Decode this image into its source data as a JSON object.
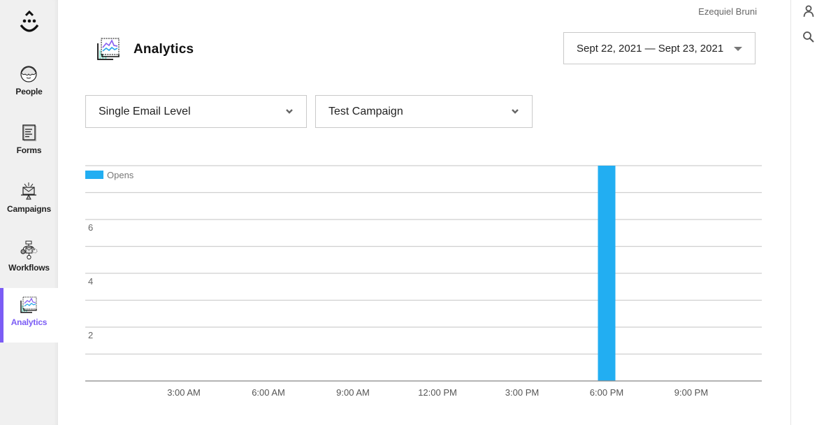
{
  "sidebar": {
    "logo": "smiley-logo-icon",
    "items": [
      {
        "label": "People",
        "icon": "people-icon",
        "active": false
      },
      {
        "label": "Forms",
        "icon": "forms-icon",
        "active": false
      },
      {
        "label": "Campaigns",
        "icon": "campaigns-icon",
        "active": false
      },
      {
        "label": "Workflows",
        "icon": "workflows-icon",
        "active": false
      },
      {
        "label": "Analytics",
        "icon": "analytics-icon",
        "active": true
      }
    ]
  },
  "header": {
    "user_name": "Ezequiel Bruni",
    "page_title": "Analytics",
    "date_range": "Sept 22, 2021 — Sept 23, 2021"
  },
  "filters": {
    "level": "Single Email Level",
    "campaign": "Test Campaign"
  },
  "right_panel": {
    "icons": [
      "user-icon",
      "search-icon"
    ]
  },
  "colors": {
    "accent": "#7b5cf5",
    "bar": "#22aef2"
  },
  "chart_data": {
    "type": "bar",
    "title": "",
    "xlabel": "",
    "ylabel": "",
    "legend": [
      {
        "name": "Opens",
        "color": "#22aef2"
      }
    ],
    "legend_position": "top-left",
    "grid": true,
    "x_unit": "hours",
    "xlim": [
      -0.5,
      23.5
    ],
    "ylim": [
      0,
      8
    ],
    "x_ticks": [
      {
        "hour": 3,
        "label": "3:00 AM"
      },
      {
        "hour": 6,
        "label": "6:00 AM"
      },
      {
        "hour": 9,
        "label": "9:00 AM"
      },
      {
        "hour": 12,
        "label": "12:00 PM"
      },
      {
        "hour": 15,
        "label": "3:00 PM"
      },
      {
        "hour": 18,
        "label": "6:00 PM"
      },
      {
        "hour": 21,
        "label": "9:00 PM"
      }
    ],
    "y_ticks": [
      {
        "value": 2,
        "label": "2"
      },
      {
        "value": 4,
        "label": "4"
      },
      {
        "value": 6,
        "label": "6"
      }
    ],
    "y_gridlines": [
      1,
      2,
      3,
      4,
      5,
      6,
      7,
      8
    ],
    "series": [
      {
        "name": "Opens",
        "points": [
          {
            "hour": 18,
            "value": 8
          }
        ]
      }
    ]
  }
}
